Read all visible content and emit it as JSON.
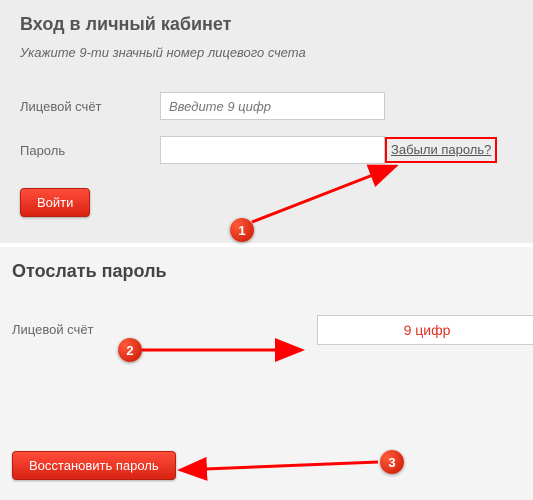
{
  "login": {
    "title": "Вход в личный кабинет",
    "subtitle": "Укажите 9-ти значный номер лицевого счета",
    "account_label": "Лицевой счёт",
    "account_placeholder": "Введите 9 цифр",
    "password_label": "Пароль",
    "forgot_link": "Забыли пароль?",
    "submit_label": "Войти"
  },
  "recover": {
    "title": "Отослать пароль",
    "account_label": "Лицевой счёт",
    "account_hint": "9 цифр",
    "submit_label": "Восстановить пароль"
  },
  "annotations": {
    "badge1": "1",
    "badge2": "2",
    "badge3": "3"
  },
  "colors": {
    "accent_red": "#e22b18",
    "panel_bg": "#ededed"
  }
}
